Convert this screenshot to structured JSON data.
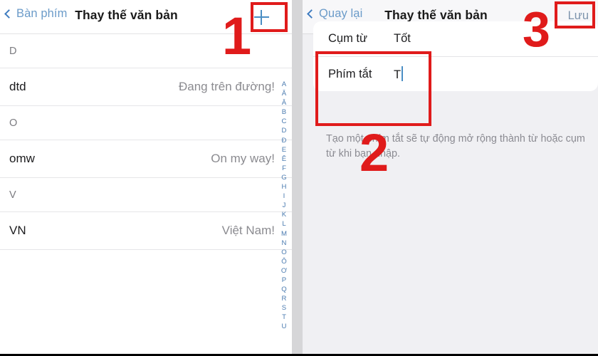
{
  "left_panel": {
    "nav": {
      "back_label": "Bàn phím",
      "back_icon": "chevron-left-icon",
      "title": "Thay thế văn bản",
      "add_icon": "plus-icon"
    },
    "sections": [
      {
        "header": "D",
        "rows": [
          {
            "shortcut": "dtd",
            "phrase": "Đang trên đường!"
          }
        ]
      },
      {
        "header": "O",
        "rows": [
          {
            "shortcut": "omw",
            "phrase": "On my way!"
          }
        ]
      },
      {
        "header": "V",
        "rows": [
          {
            "shortcut": "VN",
            "phrase": "Việt Nam!"
          }
        ]
      }
    ],
    "alphabet_index": [
      "A",
      "Ă",
      "Â",
      "B",
      "C",
      "D",
      "Đ",
      "E",
      "Ê",
      "F",
      "G",
      "H",
      "I",
      "J",
      "K",
      "L",
      "M",
      "N",
      "O",
      "Ô",
      "Ơ",
      "P",
      "Q",
      "R",
      "S",
      "T",
      "U"
    ]
  },
  "right_panel": {
    "nav": {
      "back_label": "Quay lại",
      "back_icon": "chevron-left-icon",
      "title": "Thay thế văn bản",
      "save_label": "Lưu"
    },
    "form": {
      "phrase_label": "Cụm từ",
      "phrase_value": "Tốt",
      "shortcut_label": "Phím tắt",
      "shortcut_value": "T",
      "hint": "Tạo một phím tắt sẽ tự động mở rộng thành từ hoặc cụm từ khi bạn nhập."
    }
  },
  "annotations": {
    "step_1": "1",
    "step_2": "2",
    "step_3": "3",
    "color": "#e01b1b"
  },
  "colors": {
    "accent_blue": "#4a8ec4",
    "link_blue": "#6b9bc9",
    "annotation_red": "#e01b1b",
    "panel_bg": "#f0f0f3",
    "card_bg": "#ffffff"
  }
}
